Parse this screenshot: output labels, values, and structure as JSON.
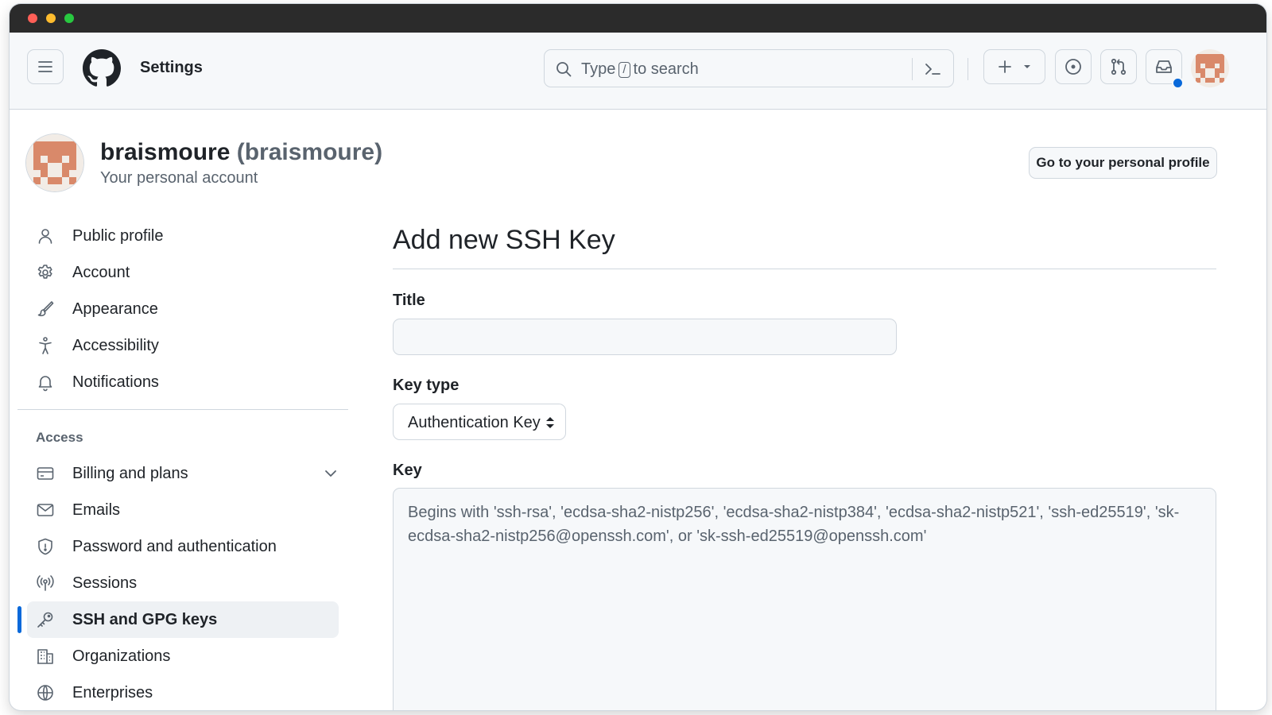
{
  "header": {
    "brand": "Settings",
    "search": {
      "prefix": "Type",
      "shortcut": "/",
      "suffix": "to search"
    }
  },
  "profile": {
    "display_name": "braismoure",
    "login": "(braismoure)",
    "subtitle": "Your personal account",
    "go_to_profile_label": "Go to your personal profile"
  },
  "sidebar": {
    "items": [
      {
        "label": "Public profile",
        "icon": "person-icon"
      },
      {
        "label": "Account",
        "icon": "gear-icon"
      },
      {
        "label": "Appearance",
        "icon": "paintbrush-icon"
      },
      {
        "label": "Accessibility",
        "icon": "accessibility-icon"
      },
      {
        "label": "Notifications",
        "icon": "bell-icon"
      }
    ],
    "access_heading": "Access",
    "access_items": [
      {
        "label": "Billing and plans",
        "icon": "credit-card-icon"
      },
      {
        "label": "Emails",
        "icon": "mail-icon"
      },
      {
        "label": "Password and authentication",
        "icon": "shield-icon"
      },
      {
        "label": "Sessions",
        "icon": "broadcast-icon"
      },
      {
        "label": "SSH and GPG keys",
        "icon": "key-icon",
        "active": true
      },
      {
        "label": "Organizations",
        "icon": "organization-icon"
      },
      {
        "label": "Enterprises",
        "icon": "globe-icon"
      }
    ]
  },
  "form": {
    "heading": "Add new SSH Key",
    "title_label": "Title",
    "title_value": "",
    "key_type_label": "Key type",
    "key_type_value": "Authentication Key",
    "key_label": "Key",
    "key_placeholder": "Begins with 'ssh-rsa', 'ecdsa-sha2-nistp256', 'ecdsa-sha2-nistp384', 'ecdsa-sha2-nistp521', 'ssh-ed25519', 'sk-ecdsa-sha2-nistp256@openssh.com', or 'sk-ssh-ed25519@openssh.com'"
  },
  "colors": {
    "accent": "#0969da",
    "avatar_orange": "#d9896a",
    "avatar_bg": "#f2ece6",
    "notification_dot": "#0969da"
  }
}
